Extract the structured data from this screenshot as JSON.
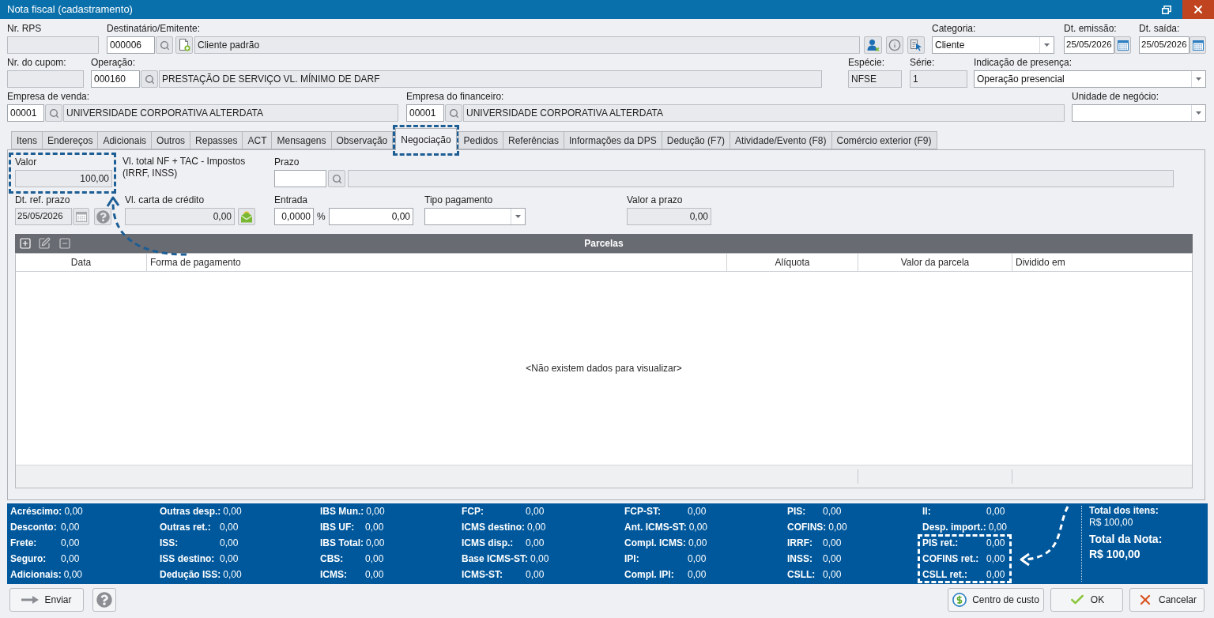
{
  "window": {
    "title": "Nota fiscal (cadastramento)"
  },
  "header": {
    "nr_rps": {
      "label": "Nr. RPS"
    },
    "recipient": {
      "label": "Destinatário/Emitente:",
      "code": "000006",
      "name": "Cliente padrão"
    },
    "category": {
      "label": "Categoria:",
      "value": "Cliente"
    },
    "issue_date": {
      "label": "Dt. emissão:",
      "value": "25/05/2026"
    },
    "exit_date": {
      "label": "Dt. saída:",
      "value": "25/05/2026"
    },
    "coupon_number": {
      "label": "Nr. do cupom:"
    },
    "operation": {
      "label": "Operação:",
      "code": "000160",
      "name": "PRESTAÇÃO DE SERVIÇO VL. MÍNIMO DE DARF"
    },
    "species": {
      "label": "Espécie:",
      "value": "NFSE"
    },
    "series": {
      "label": "Série:",
      "value": "1"
    },
    "presence": {
      "label": "Indicação de presença:",
      "value": "Operação presencial"
    },
    "sales_company": {
      "label": "Empresa de venda:",
      "code": "00001",
      "name": "UNIVERSIDADE CORPORATIVA ALTERDATA"
    },
    "finance_company": {
      "label": "Empresa do financeiro:",
      "code": "00001",
      "name": "UNIVERSIDADE CORPORATIVA ALTERDATA"
    },
    "business_unit": {
      "label": "Unidade de negócio:"
    }
  },
  "tabs": [
    {
      "label": "Itens",
      "selected": false,
      "highlighted": false
    },
    {
      "label": "Endereços",
      "selected": false,
      "highlighted": false
    },
    {
      "label": "Adicionais",
      "selected": false,
      "highlighted": false
    },
    {
      "label": "Outros",
      "selected": false,
      "highlighted": false
    },
    {
      "label": "Repasses",
      "selected": false,
      "highlighted": false
    },
    {
      "label": "ACT",
      "selected": false,
      "highlighted": false
    },
    {
      "label": "Mensagens",
      "selected": false,
      "highlighted": false
    },
    {
      "label": "Observação",
      "selected": false,
      "highlighted": false
    },
    {
      "label": "Negociação",
      "selected": true,
      "highlighted": true
    },
    {
      "label": "Pedidos",
      "selected": false,
      "highlighted": false
    },
    {
      "label": "Referências",
      "selected": false,
      "highlighted": false
    },
    {
      "label": "Informações da DPS",
      "selected": false,
      "highlighted": false
    },
    {
      "label": "Dedução (F7)",
      "selected": false,
      "highlighted": false
    },
    {
      "label": "Atividade/Evento (F8)",
      "selected": false,
      "highlighted": false
    },
    {
      "label": "Comércio exterior (F9)",
      "selected": false,
      "highlighted": false
    }
  ],
  "negotiation": {
    "valor": {
      "label": "Valor",
      "value": "100,00",
      "highlighted": true
    },
    "valor_note": "Vl. total NF + TAC - Impostos (IRRF, INSS)",
    "term": {
      "label": "Prazo"
    },
    "term_ref_date": {
      "label": "Dt. ref. prazo",
      "value": "25/05/2026"
    },
    "credit_letter": {
      "label": "Vl. carta de crédito",
      "value": "0,00"
    },
    "down_payment": {
      "label": "Entrada",
      "percent": "0,0000",
      "unit": "%",
      "amount": "0,00"
    },
    "payment_type": {
      "label": "Tipo pagamento"
    },
    "term_value": {
      "label": "Valor a prazo",
      "value": "0,00"
    }
  },
  "installments": {
    "title": "Parcelas",
    "columns": [
      "Data",
      "Forma de pagamento",
      "Alíquota",
      "Valor da parcela",
      "Dividido em"
    ],
    "empty_message": "<Não existem dados para visualizar>"
  },
  "totals": {
    "columns": [
      [
        {
          "label": "Acréscimo:",
          "value": "0,00",
          "highlighted": false
        },
        {
          "label": "Desconto:",
          "value": "0,00",
          "highlighted": false
        },
        {
          "label": "Frete:",
          "value": "0,00",
          "highlighted": false
        },
        {
          "label": "Seguro:",
          "value": "0,00",
          "highlighted": false
        },
        {
          "label": "Adicionais:",
          "value": "0,00",
          "highlighted": false
        }
      ],
      [
        {
          "label": "Outras desp.:",
          "value": "0,00",
          "highlighted": false
        },
        {
          "label": "Outras ret.:",
          "value": "0,00",
          "highlighted": false
        },
        {
          "label": "ISS:",
          "value": "0,00",
          "highlighted": false
        },
        {
          "label": "ISS destino:",
          "value": "0,00",
          "highlighted": false
        },
        {
          "label": "Dedução ISS:",
          "value": "0,00",
          "highlighted": false
        }
      ],
      [
        {
          "label": "IBS Mun.:",
          "value": "0,00",
          "highlighted": false
        },
        {
          "label": "IBS UF:",
          "value": "0,00",
          "highlighted": false
        },
        {
          "label": "IBS Total:",
          "value": "0,00",
          "highlighted": false
        },
        {
          "label": "CBS:",
          "value": "0,00",
          "highlighted": false
        },
        {
          "label": "ICMS:",
          "value": "0,00",
          "highlighted": false
        }
      ],
      [
        {
          "label": "FCP:",
          "value": "0,00",
          "highlighted": false
        },
        {
          "label": "ICMS destino:",
          "value": "0,00",
          "highlighted": false
        },
        {
          "label": "ICMS disp.:",
          "value": "0,00",
          "highlighted": false
        },
        {
          "label": "Base ICMS-ST:",
          "value": "0,00",
          "highlighted": false
        },
        {
          "label": "ICMS-ST:",
          "value": "0,00",
          "highlighted": false
        }
      ],
      [
        {
          "label": "FCP-ST:",
          "value": "0,00",
          "highlighted": false
        },
        {
          "label": "Ant. ICMS-ST:",
          "value": "0,00",
          "highlighted": false
        },
        {
          "label": "Compl. ICMS:",
          "value": "0,00",
          "highlighted": false
        },
        {
          "label": "IPI:",
          "value": "0,00",
          "highlighted": false
        },
        {
          "label": "Compl. IPI:",
          "value": "0,00",
          "highlighted": false
        }
      ],
      [
        {
          "label": "PIS:",
          "value": "0,00",
          "highlighted": false
        },
        {
          "label": "COFINS:",
          "value": "0,00",
          "highlighted": false
        },
        {
          "label": "IRRF:",
          "value": "0,00",
          "highlighted": false
        },
        {
          "label": "INSS:",
          "value": "0,00",
          "highlighted": false
        },
        {
          "label": "CSLL:",
          "value": "0,00",
          "highlighted": false
        }
      ],
      [
        {
          "label": "II:",
          "value": "0,00",
          "highlighted": false
        },
        {
          "label": "Desp. import.:",
          "value": "0,00",
          "highlighted": false
        },
        {
          "label": "PIS ret.:",
          "value": "0,00",
          "highlighted": true
        },
        {
          "label": "COFINS ret.:",
          "value": "0,00",
          "highlighted": true
        },
        {
          "label": "CSLL ret.:",
          "value": "0,00",
          "highlighted": true
        }
      ]
    ],
    "summary": [
      {
        "kind": "items",
        "label": "Total dos itens:",
        "value": "R$ 100,00"
      },
      {
        "kind": "note",
        "label": "Total da Nota:",
        "value": "R$ 100,00"
      }
    ]
  },
  "footer": {
    "left": [
      {
        "kind": "send",
        "label": "Enviar"
      },
      {
        "kind": "help"
      }
    ],
    "right": [
      {
        "kind": "cost_center",
        "label": "Centro de custo"
      },
      {
        "kind": "ok",
        "label": "OK"
      },
      {
        "kind": "cancel",
        "label": "Cancelar"
      }
    ]
  }
}
